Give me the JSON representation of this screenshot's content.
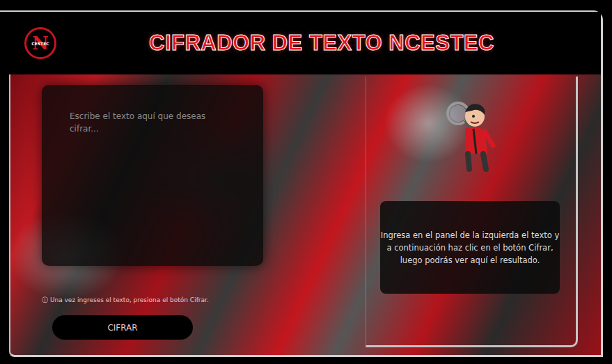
{
  "header": {
    "title": "CIFRADOR DE TEXTO NCESTEC",
    "logo": {
      "letter": "N",
      "text": "CESTEC"
    }
  },
  "input": {
    "placeholder": "Escribe el texto aquí que deseas cifrar..."
  },
  "hint": {
    "icon": "ⓘ",
    "text": "Una vez ingreses el texto, presiona el botón Cifrar."
  },
  "button": {
    "label": "CIFRAR"
  },
  "output": {
    "text": "Ingresa en el panel de la izquierda el texto y a continuación haz clic en el botón Cifrar, luego podrás ver aquí el resultado."
  }
}
